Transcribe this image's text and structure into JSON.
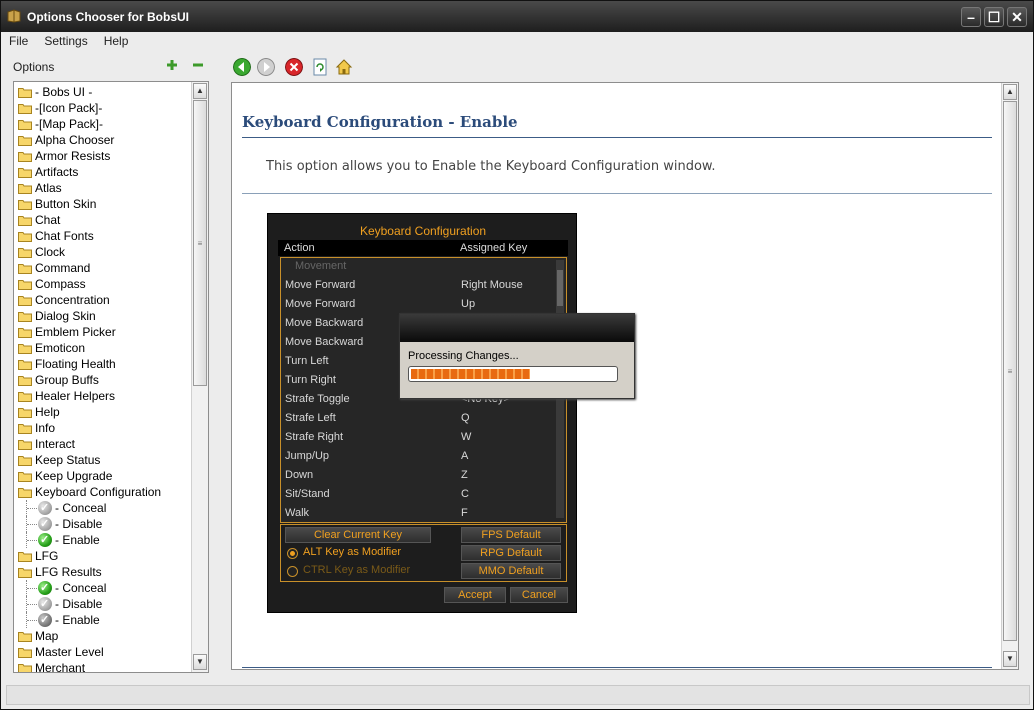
{
  "window": {
    "title": "Options Chooser for BobsUI"
  },
  "menu": [
    "File",
    "Settings",
    "Help"
  ],
  "left_panel": {
    "header": "Options",
    "items": [
      {
        "label": "- Bobs UI -"
      },
      {
        "label": "-[Icon Pack]-"
      },
      {
        "label": "-[Map Pack]-"
      },
      {
        "label": "Alpha Chooser"
      },
      {
        "label": "Armor Resists"
      },
      {
        "label": "Artifacts"
      },
      {
        "label": "Atlas"
      },
      {
        "label": "Button Skin"
      },
      {
        "label": "Chat"
      },
      {
        "label": "Chat Fonts"
      },
      {
        "label": "Clock"
      },
      {
        "label": "Command"
      },
      {
        "label": "Compass"
      },
      {
        "label": "Concentration"
      },
      {
        "label": "Dialog Skin"
      },
      {
        "label": "Emblem Picker"
      },
      {
        "label": "Emoticon"
      },
      {
        "label": "Floating Health"
      },
      {
        "label": "Group Buffs"
      },
      {
        "label": "Healer Helpers"
      },
      {
        "label": "Help"
      },
      {
        "label": "Info"
      },
      {
        "label": "Interact"
      },
      {
        "label": "Keep Status"
      },
      {
        "label": "Keep Upgrade"
      },
      {
        "label": "Keyboard Configuration"
      },
      {
        "label": "- Conceal",
        "child": true,
        "state": "gray"
      },
      {
        "label": "- Disable",
        "child": true,
        "state": "gray"
      },
      {
        "label": "- Enable",
        "child": true,
        "state": "green"
      },
      {
        "label": "LFG"
      },
      {
        "label": "LFG Results"
      },
      {
        "label": "- Conceal",
        "child": true,
        "state": "green"
      },
      {
        "label": "- Disable",
        "child": true,
        "state": "gray"
      },
      {
        "label": "- Enable",
        "child": true,
        "state": "dgray"
      },
      {
        "label": "Map"
      },
      {
        "label": "Master Level"
      },
      {
        "label": "Merchant"
      }
    ]
  },
  "content": {
    "heading": "Keyboard Configuration - Enable",
    "description": "This option allows you to Enable the Keyboard Configuration window."
  },
  "preview": {
    "title": "Keyboard Configuration",
    "col_action": "Action",
    "col_key": "Assigned Key",
    "rows": [
      {
        "action": "Movement",
        "key": "",
        "category": true
      },
      {
        "action": "Move Forward",
        "key": "Right Mouse"
      },
      {
        "action": "Move Forward",
        "key": "Up"
      },
      {
        "action": "Move Backward",
        "key": ""
      },
      {
        "action": "Move Backward",
        "key": ""
      },
      {
        "action": "Turn Left",
        "key": ""
      },
      {
        "action": "Turn Right",
        "key": ""
      },
      {
        "action": "Strafe Toggle",
        "key": "<No Key>"
      },
      {
        "action": "Strafe Left",
        "key": "Q"
      },
      {
        "action": "Strafe Right",
        "key": "W"
      },
      {
        "action": "Jump/Up",
        "key": "A"
      },
      {
        "action": "Down",
        "key": "Z"
      },
      {
        "action": "Sit/Stand",
        "key": "C"
      },
      {
        "action": "Walk",
        "key": "F"
      }
    ],
    "clear_key": "Clear Current Key",
    "fps_default": "FPS Default",
    "rpg_default": "RPG Default",
    "mmo_default": "MMO Default",
    "alt_modifier": "ALT Key as Modifier",
    "ctrl_modifier": "CTRL Key as Modifier",
    "accept": "Accept",
    "cancel": "Cancel"
  },
  "popup": {
    "text": "Processing Changes...",
    "progress": 0.58
  },
  "colors": {
    "heading": "#2b4b7a",
    "accent_orange": "#f0a020",
    "progress": "#e86a10"
  }
}
